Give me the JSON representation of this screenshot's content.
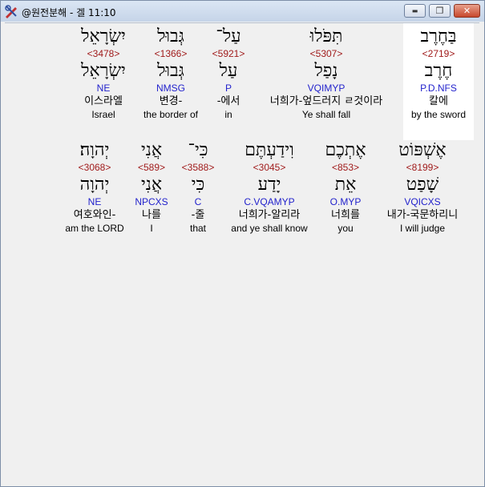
{
  "window": {
    "title": "@원전분해 - 겔 11:10",
    "minimize_glyph": "▬",
    "maximize_glyph": "❐",
    "close_glyph": "✕"
  },
  "row1": [
    {
      "hebrew": "יִשְׂרָאֵל",
      "strong": "<3478>",
      "lemma": "יִשְׂרָאֵל",
      "morph": "NE",
      "korean": "이스라엘",
      "english": "Israel"
    },
    {
      "hebrew": "גְּבוּל",
      "strong": "<1366>",
      "lemma": "גְּבוּל",
      "morph": "NMSG",
      "korean": "변경-",
      "english": "the border of"
    },
    {
      "hebrew": "עַל־",
      "strong": "<5921>",
      "lemma": "עַל",
      "morph": "P",
      "korean": "-에서",
      "english": "in"
    },
    {
      "hebrew": "תִּפֹּלוּ",
      "strong": "<5307>",
      "lemma": "נָפַל",
      "morph": "VQIMYP",
      "korean": "너희가-엎드러지 ㄹ것이라",
      "english": "Ye shall fall"
    },
    {
      "hebrew": "בַּחֶרֶב",
      "strong": "<2719>",
      "lemma": "חֶרֶב",
      "morph": "P.D.NFS",
      "korean": "칼에",
      "english": "by the sword"
    }
  ],
  "row2": [
    {
      "hebrew": "יְהוָה׃",
      "strong": "<3068>",
      "lemma": "יְהוָה",
      "morph": "NE",
      "korean": "여호와인-",
      "english": "am the LORD"
    },
    {
      "hebrew": "אֲנִי",
      "strong": "<589>",
      "lemma": "אֲנִי",
      "morph": "NPCXS",
      "korean": "나를",
      "english": "I"
    },
    {
      "hebrew": "כִּי־",
      "strong": "<3588>",
      "lemma": "כִּי",
      "morph": "C",
      "korean": "-줄",
      "english": "that"
    },
    {
      "hebrew": "וִידַעְתֶּם",
      "strong": "<3045>",
      "lemma": "יָדַע",
      "morph": "C.VQAMYP",
      "korean": "너희가-알리라",
      "english": "and ye shall know"
    },
    {
      "hebrew": "אֶתְכֶם",
      "strong": "<853>",
      "lemma": "אֵת",
      "morph": "O.MYP",
      "korean": "너희를",
      "english": "you"
    },
    {
      "hebrew": "אֶשְׁפּוֹט",
      "strong": "<8199>",
      "lemma": "שָׁפַט",
      "morph": "VQICXS",
      "korean": "내가-국문하리니",
      "english": "I will judge"
    }
  ]
}
